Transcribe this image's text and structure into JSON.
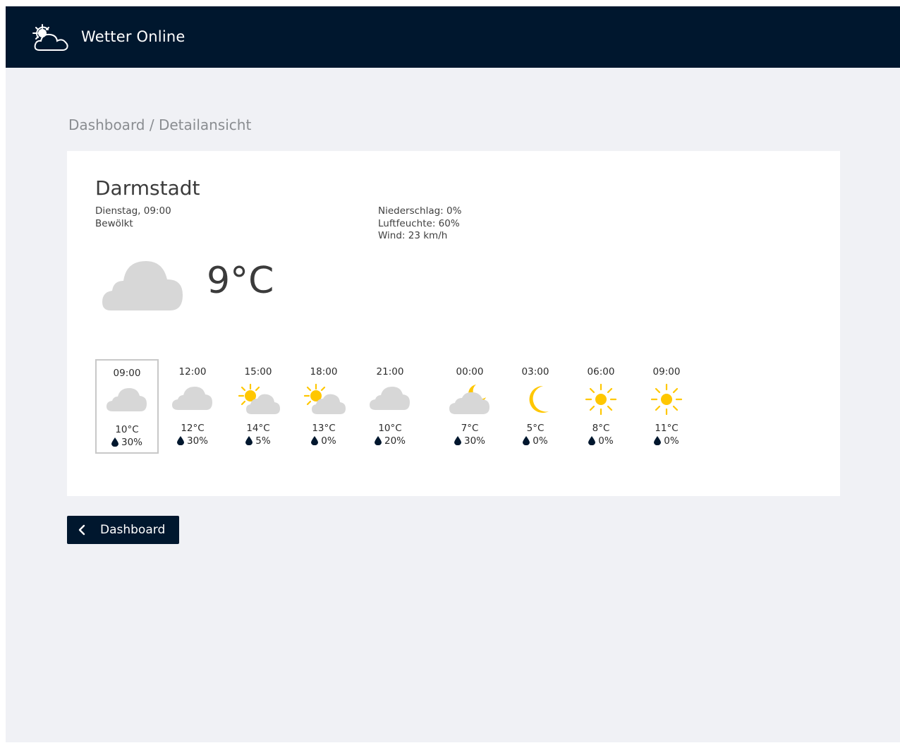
{
  "app": {
    "title": "Wetter Online",
    "logo_icon": "sun-cloud-outline-icon"
  },
  "breadcrumb": "Dashboard / Detailansicht",
  "current": {
    "city": "Darmstadt",
    "datetime": "Dienstag, 09:00",
    "condition": "Bewölkt",
    "precipitation": "Niederschlag: 0%",
    "humidity": "Luftfeuchte: 60%",
    "wind": "Wind: 23 km/h",
    "temperature": "9°C",
    "icon": "cloud-icon"
  },
  "hourly": [
    {
      "time": "09:00",
      "temp": "10°C",
      "rain": "30%",
      "icon": "cloud",
      "selected": true
    },
    {
      "time": "12:00",
      "temp": "12°C",
      "rain": "30%",
      "icon": "cloud"
    },
    {
      "time": "15:00",
      "temp": "14°C",
      "rain": "5%",
      "icon": "sun-cloud"
    },
    {
      "time": "18:00",
      "temp": "13°C",
      "rain": "0%",
      "icon": "sun-cloud"
    },
    {
      "time": "21:00",
      "temp": "10°C",
      "rain": "20%",
      "icon": "cloud"
    },
    {
      "time": "00:00",
      "temp": "7°C",
      "rain": "30%",
      "icon": "moon-cloud"
    },
    {
      "time": "03:00",
      "temp": "5°C",
      "rain": "0%",
      "icon": "moon"
    },
    {
      "time": "06:00",
      "temp": "8°C",
      "rain": "0%",
      "icon": "sun"
    },
    {
      "time": "09:00",
      "temp": "11°C",
      "rain": "0%",
      "icon": "sun"
    }
  ],
  "back_button": {
    "label": "Dashboard",
    "icon": "chevron-left-icon"
  },
  "colors": {
    "header_bg": "#00172e",
    "page_bg": "#f0f1f5",
    "cloud": "#d7d7d7",
    "sun": "#ffc700",
    "drop": "#00172e"
  }
}
